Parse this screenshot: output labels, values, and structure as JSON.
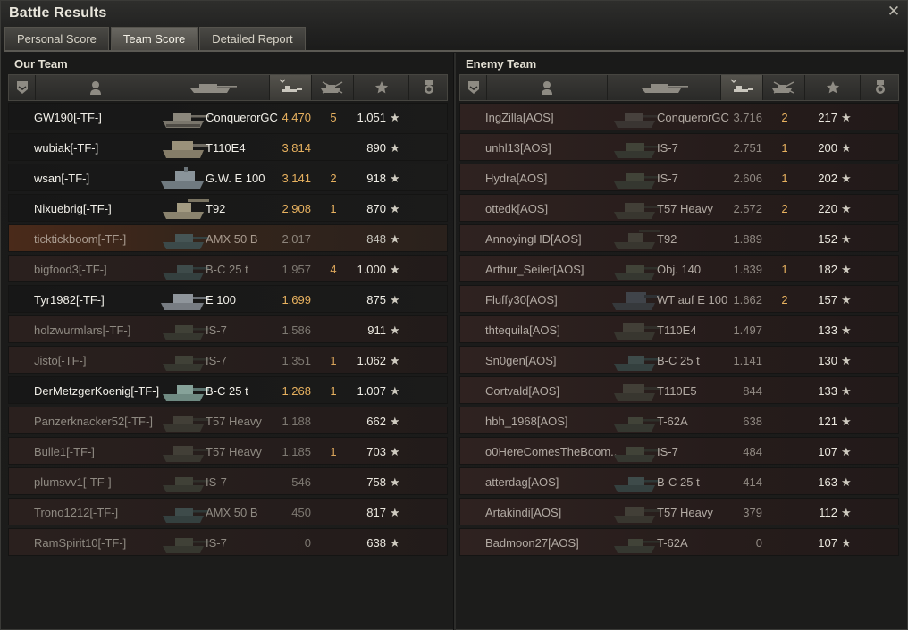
{
  "window": {
    "title": "Battle Results",
    "close_icon": "close-icon"
  },
  "tabs": [
    {
      "label": "Personal Score"
    },
    {
      "label": "Team Score",
      "active": true
    },
    {
      "label": "Detailed Report"
    }
  ],
  "our_team": {
    "title": "Our Team",
    "rows": [
      {
        "player": "GW190[-TF-]",
        "tank": "ConquerorGC",
        "xp": "4.470",
        "kills": "5",
        "damage": "1.051",
        "state": "alive"
      },
      {
        "player": "wubiak[-TF-]",
        "tank": "T110E4",
        "xp": "3.814",
        "kills": "",
        "damage": "890",
        "state": "alive"
      },
      {
        "player": "wsan[-TF-]",
        "tank": "G.W. E 100",
        "xp": "3.141",
        "kills": "2",
        "damage": "918",
        "state": "alive"
      },
      {
        "player": "Nixuebrig[-TF-]",
        "tank": "T92",
        "xp": "2.908",
        "kills": "1",
        "damage": "870",
        "state": "alive"
      },
      {
        "player": "ticktickboom[-TF-]",
        "tank": "AMX 50 B",
        "xp": "2.017",
        "kills": "",
        "damage": "848",
        "state": "me"
      },
      {
        "player": "bigfood3[-TF-]",
        "tank": "B-C 25 t",
        "xp": "1.957",
        "kills": "4",
        "damage": "1.000",
        "state": "dead"
      },
      {
        "player": "Tyr1982[-TF-]",
        "tank": "E 100",
        "xp": "1.699",
        "kills": "",
        "damage": "875",
        "state": "alive"
      },
      {
        "player": "holzwurmlars[-TF-]",
        "tank": "IS-7",
        "xp": "1.586",
        "kills": "",
        "damage": "911",
        "state": "dead"
      },
      {
        "player": "Jisto[-TF-]",
        "tank": "IS-7",
        "xp": "1.351",
        "kills": "1",
        "damage": "1.062",
        "state": "dead"
      },
      {
        "player": "DerMetzgerKoenig[-TF-]",
        "tank": "B-C 25 t",
        "xp": "1.268",
        "kills": "1",
        "damage": "1.007",
        "state": "alive"
      },
      {
        "player": "Panzerknacker52[-TF-]",
        "tank": "T57 Heavy",
        "xp": "1.188",
        "kills": "",
        "damage": "662",
        "state": "dead"
      },
      {
        "player": "Bulle1[-TF-]",
        "tank": "T57 Heavy",
        "xp": "1.185",
        "kills": "1",
        "damage": "703",
        "state": "dead"
      },
      {
        "player": "plumsvv1[-TF-]",
        "tank": "IS-7",
        "xp": "546",
        "kills": "",
        "damage": "758",
        "state": "dead"
      },
      {
        "player": "Trono1212[-TF-]",
        "tank": "AMX 50 B",
        "xp": "450",
        "kills": "",
        "damage": "817",
        "state": "dead"
      },
      {
        "player": "RamSpirit10[-TF-]",
        "tank": "IS-7",
        "xp": "0",
        "kills": "",
        "damage": "638",
        "state": "dead"
      }
    ]
  },
  "enemy_team": {
    "title": "Enemy Team",
    "rows": [
      {
        "player": "IngZilla[AOS]",
        "tank": "ConquerorGC",
        "xp": "3.716",
        "kills": "2",
        "damage": "217"
      },
      {
        "player": "unhl13[AOS]",
        "tank": "IS-7",
        "xp": "2.751",
        "kills": "1",
        "damage": "200"
      },
      {
        "player": "Hydra[AOS]",
        "tank": "IS-7",
        "xp": "2.606",
        "kills": "1",
        "damage": "202"
      },
      {
        "player": "ottedk[AOS]",
        "tank": "T57 Heavy",
        "xp": "2.572",
        "kills": "2",
        "damage": "220"
      },
      {
        "player": "AnnoyingHD[AOS]",
        "tank": "T92",
        "xp": "1.889",
        "kills": "",
        "damage": "152"
      },
      {
        "player": "Arthur_Seiler[AOS]",
        "tank": "Obj. 140",
        "xp": "1.839",
        "kills": "1",
        "damage": "182"
      },
      {
        "player": "Fluffy30[AOS]",
        "tank": "WT auf E 100",
        "xp": "1.662",
        "kills": "2",
        "damage": "157"
      },
      {
        "player": "thtequila[AOS]",
        "tank": "T110E4",
        "xp": "1.497",
        "kills": "",
        "damage": "133"
      },
      {
        "player": "Sn0gen[AOS]",
        "tank": "B-C 25 t",
        "xp": "1.141",
        "kills": "",
        "damage": "130"
      },
      {
        "player": "Cortvald[AOS]",
        "tank": "T110E5",
        "xp": "844",
        "kills": "",
        "damage": "133"
      },
      {
        "player": "hbh_1968[AOS]",
        "tank": "T-62A",
        "xp": "638",
        "kills": "",
        "damage": "121"
      },
      {
        "player": "o0HereComesTheBoom..",
        "tank": "IS-7",
        "xp": "484",
        "kills": "",
        "damage": "107"
      },
      {
        "player": "atterdag[AOS]",
        "tank": "B-C 25 t",
        "xp": "414",
        "kills": "",
        "damage": "163"
      },
      {
        "player": "Artakindi[AOS]",
        "tank": "T57 Heavy",
        "xp": "379",
        "kills": "",
        "damage": "112"
      },
      {
        "player": "Badmoon27[AOS]",
        "tank": "T-62A",
        "xp": "0",
        "kills": "",
        "damage": "107"
      }
    ]
  },
  "star_glyph": "★",
  "colors": {
    "xp_alive": "#e7b15f",
    "row_me": "#4a2a1a",
    "row_enemy": "#2f2220"
  }
}
